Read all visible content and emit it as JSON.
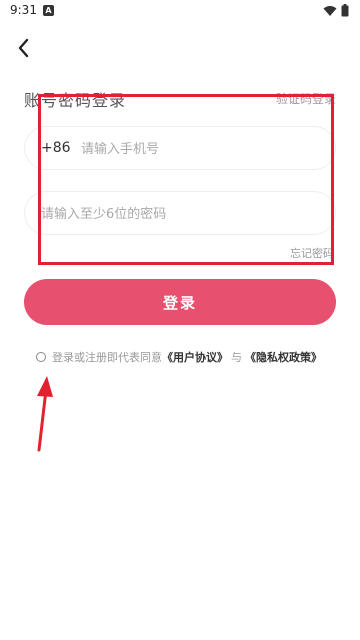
{
  "status_bar": {
    "time": "9:31",
    "notification_letter": "A"
  },
  "header": {
    "title": "账号密码登录",
    "switch_link": "验证码登录"
  },
  "form": {
    "country_code": "+86",
    "phone_placeholder": "请输入手机号",
    "password_placeholder": "请输入至少6位的密码",
    "forgot_password": "忘记密码"
  },
  "login_button": "登录",
  "agreement": {
    "prefix": "登录或注册即代表同意",
    "user_agreement": "《用户协议》",
    "connector": "与",
    "privacy_policy": "《隐私权政策》"
  },
  "colors": {
    "accent": "#e8506f",
    "annotation": "#e3212e"
  }
}
